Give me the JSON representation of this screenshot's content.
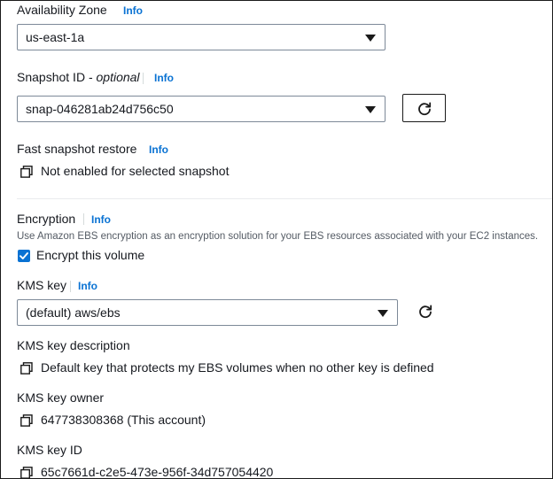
{
  "availability_zone": {
    "label": "Availability Zone",
    "info": "Info",
    "selected": "us-east-1a"
  },
  "snapshot_id": {
    "label_main": "Snapshot ID - ",
    "label_optional": "optional",
    "info": "Info",
    "selected": "snap-046281ab24d756c50"
  },
  "fast_snapshot_restore": {
    "label": "Fast snapshot restore",
    "info": "Info",
    "value": "Not enabled for selected snapshot"
  },
  "encryption": {
    "label": "Encryption",
    "info": "Info",
    "description": "Use Amazon EBS encryption as an encryption solution for your EBS resources associated with your EC2 instances.",
    "checkbox_label": "Encrypt this volume",
    "checked": true
  },
  "kms_key": {
    "label": "KMS key",
    "info": "Info",
    "selected": "(default) aws/ebs"
  },
  "kms_key_description": {
    "label": "KMS key description",
    "value": "Default key that protects my EBS volumes when no other key is defined"
  },
  "kms_key_owner": {
    "label": "KMS key owner",
    "value": "647738308368 (This account)"
  },
  "kms_key_id": {
    "label": "KMS key ID",
    "value": "65c7661d-c2e5-473e-956f-34d757054420"
  },
  "icons": {
    "caret": "caret-down-icon",
    "refresh": "refresh-icon",
    "copy": "copy-icon",
    "check": "checkmark-icon"
  },
  "colors": {
    "link": "#0972d3",
    "text": "#16191f",
    "border": "#7d8998",
    "checkbox": "#0972d3"
  }
}
